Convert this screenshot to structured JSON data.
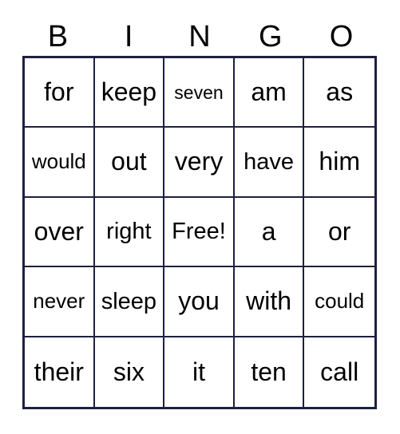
{
  "card": {
    "title": "BINGO",
    "header_letters": [
      "B",
      "I",
      "N",
      "G",
      "O"
    ],
    "border_color": "#1d2040",
    "text_color": "#000000",
    "background_color": "#ffffff",
    "rows": 5,
    "columns": 5,
    "free_space_label": "Free!",
    "free_space_position": {
      "row": 3,
      "column": 3
    }
  },
  "chart_data": {
    "type": "table",
    "title": "BINGO",
    "columns": [
      "B",
      "I",
      "N",
      "G",
      "O"
    ],
    "rows": [
      [
        "for",
        "keep",
        "seven",
        "am",
        "as"
      ],
      [
        "would",
        "out",
        "very",
        "have",
        "him"
      ],
      [
        "over",
        "right",
        "Free!",
        "a",
        "or"
      ],
      [
        "never",
        "sleep",
        "you",
        "with",
        "could"
      ],
      [
        "their",
        "six",
        "it",
        "ten",
        "call"
      ]
    ]
  },
  "cells": [
    {
      "text": "for",
      "size": "l",
      "row": 1,
      "col": 1
    },
    {
      "text": "keep",
      "size": "l",
      "row": 1,
      "col": 2
    },
    {
      "text": "seven",
      "size": "xs",
      "row": 1,
      "col": 3
    },
    {
      "text": "am",
      "size": "l",
      "row": 1,
      "col": 4
    },
    {
      "text": "as",
      "size": "l",
      "row": 1,
      "col": 5
    },
    {
      "text": "would",
      "size": "s",
      "row": 2,
      "col": 1
    },
    {
      "text": "out",
      "size": "l",
      "row": 2,
      "col": 2
    },
    {
      "text": "very",
      "size": "l",
      "row": 2,
      "col": 3
    },
    {
      "text": "have",
      "size": "m",
      "row": 2,
      "col": 4
    },
    {
      "text": "him",
      "size": "l",
      "row": 2,
      "col": 5
    },
    {
      "text": "over",
      "size": "l",
      "row": 3,
      "col": 1
    },
    {
      "text": "right",
      "size": "m",
      "row": 3,
      "col": 2
    },
    {
      "text": "Free!",
      "size": "m",
      "row": 3,
      "col": 3
    },
    {
      "text": "a",
      "size": "l",
      "row": 3,
      "col": 4
    },
    {
      "text": "or",
      "size": "l",
      "row": 3,
      "col": 5
    },
    {
      "text": "never",
      "size": "s",
      "row": 4,
      "col": 1
    },
    {
      "text": "sleep",
      "size": "m",
      "row": 4,
      "col": 2
    },
    {
      "text": "you",
      "size": "l",
      "row": 4,
      "col": 3
    },
    {
      "text": "with",
      "size": "l",
      "row": 4,
      "col": 4
    },
    {
      "text": "could",
      "size": "s",
      "row": 4,
      "col": 5
    },
    {
      "text": "their",
      "size": "l",
      "row": 5,
      "col": 1
    },
    {
      "text": "six",
      "size": "l",
      "row": 5,
      "col": 2
    },
    {
      "text": "it",
      "size": "l",
      "row": 5,
      "col": 3
    },
    {
      "text": "ten",
      "size": "l",
      "row": 5,
      "col": 4
    },
    {
      "text": "call",
      "size": "l",
      "row": 5,
      "col": 5
    }
  ]
}
